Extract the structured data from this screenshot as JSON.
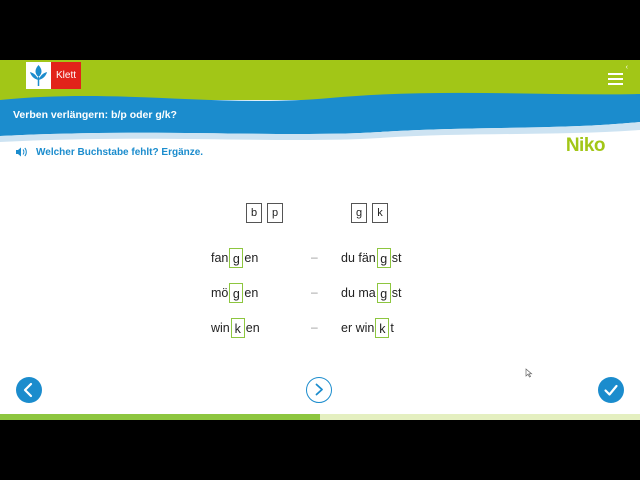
{
  "app": {
    "logo_text": "Klett",
    "brand": "Niko",
    "lesson_title": "Verben verlängern: b/p oder g/k?",
    "instruction": "Welcher Buchstabe fehlt? Ergänze."
  },
  "options": {
    "group1": [
      "b",
      "p"
    ],
    "group2": [
      "g",
      "k"
    ]
  },
  "rows": [
    {
      "left": {
        "before": "fan",
        "fill": "g",
        "after": "en"
      },
      "separator": "–",
      "right": {
        "before": "du fän",
        "fill": "g",
        "after": "st"
      }
    },
    {
      "left": {
        "before": "mö",
        "fill": "g",
        "after": "en"
      },
      "separator": "–",
      "right": {
        "before": "du ma",
        "fill": "g",
        "after": "st"
      }
    },
    {
      "left": {
        "before": "win",
        "fill": "k",
        "after": "en"
      },
      "separator": "–",
      "right": {
        "before": "er win",
        "fill": "k",
        "after": "t"
      }
    }
  ],
  "progress": 0.5,
  "icons": {
    "speaker": "speaker-icon",
    "menu": "hamburger-menu-icon",
    "prev": "arrow-left-icon",
    "play": "play-next-icon",
    "check": "checkmark-icon"
  },
  "colors": {
    "green": "#a2c617",
    "blue": "#1b8ccd",
    "red": "#e2231a",
    "answer_border": "#8dc63f"
  }
}
